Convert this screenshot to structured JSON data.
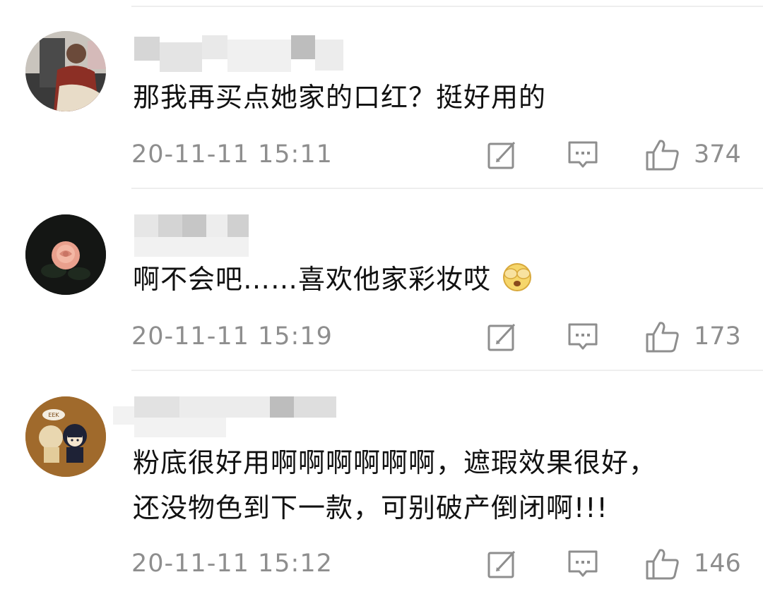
{
  "comments": [
    {
      "text_lines": [
        "那我再买点她家的口红？挺好用的"
      ],
      "timestamp": "20-11-11 15:11",
      "likes": "374"
    },
    {
      "text_lines": [
        "啊不会吧……喜欢他家彩妆哎"
      ],
      "emoji": "covering-eyes-emoji",
      "timestamp": "20-11-11 15:19",
      "likes": "173"
    },
    {
      "text_lines": [
        "粉底很好用啊啊啊啊啊啊，遮瑕效果很好，",
        "还没物色到下一款，可别破产倒闭啊!!!"
      ],
      "timestamp": "20-11-11 15:12",
      "likes": "146",
      "avatar_badge": "EEK"
    }
  ],
  "icons": {
    "repost": "repost-icon",
    "reply": "reply-icon",
    "like": "thumbs-up-icon"
  },
  "colors": {
    "meta_gray": "#8e8e8e",
    "text": "#111111",
    "divider": "#eeeeee"
  }
}
